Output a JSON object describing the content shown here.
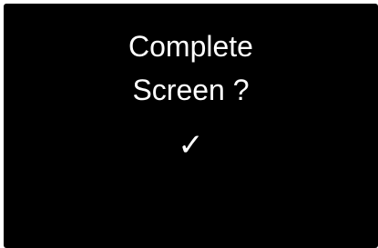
{
  "screen": {
    "background_color": "#000000",
    "text_color": "#ffffff",
    "title_line_1": "Complete",
    "title_line_2": "Screen ?",
    "confirm_glyph": "✓",
    "confirm_icon": "checkmark-icon"
  }
}
